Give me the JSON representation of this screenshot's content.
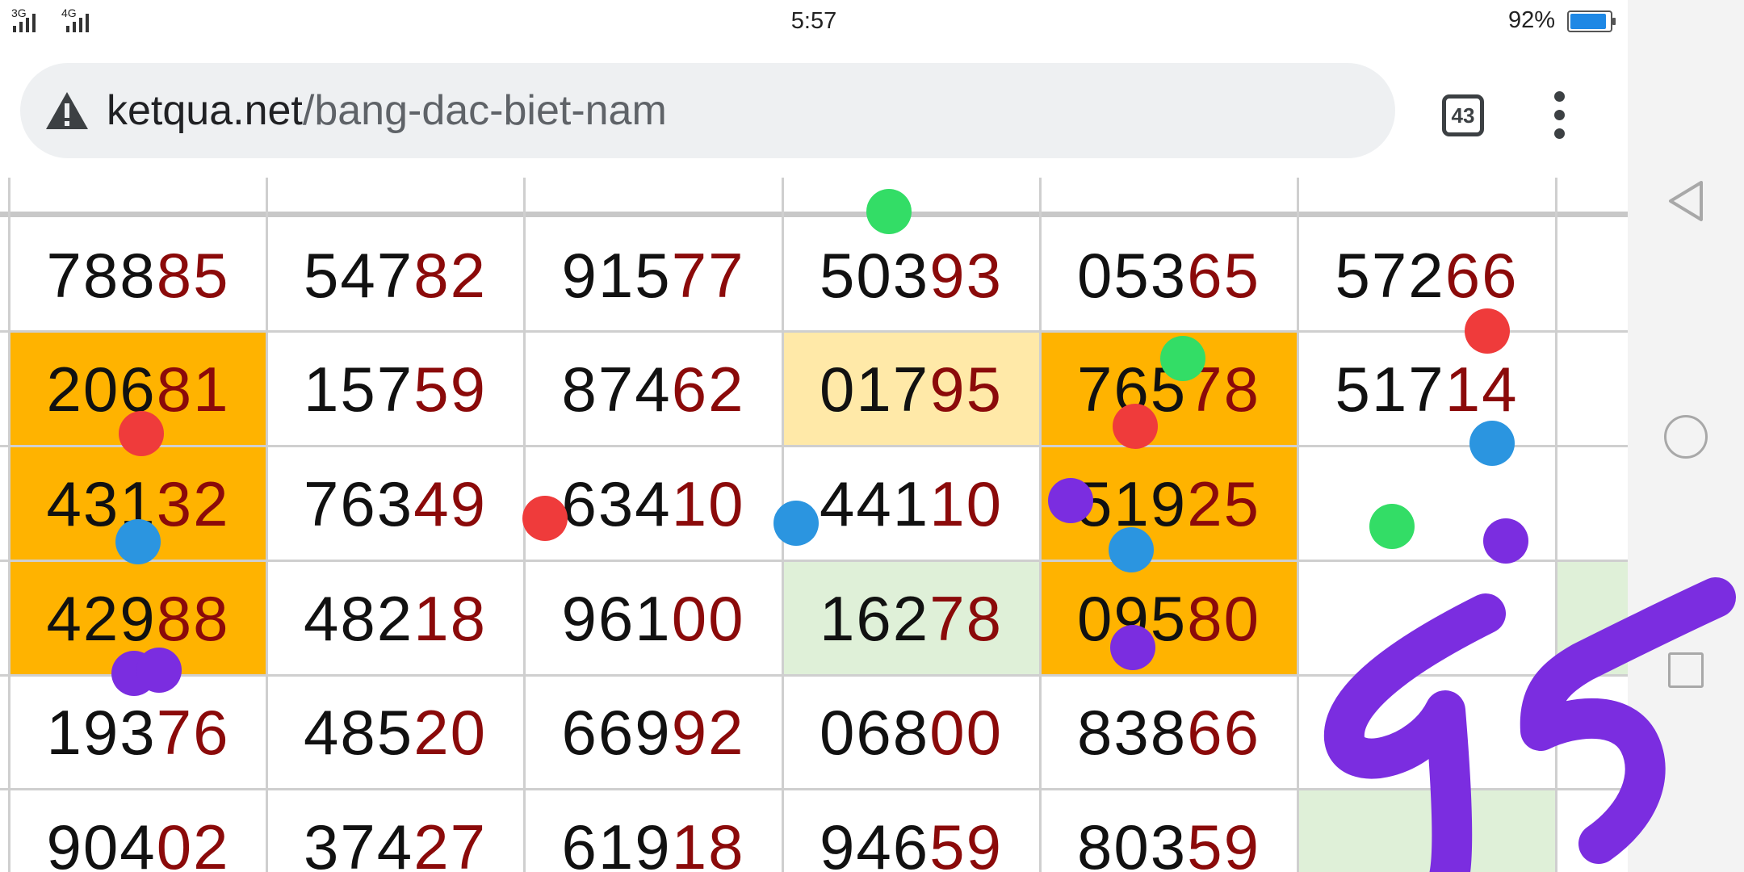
{
  "status_bar": {
    "network_1": "3G",
    "network_2": "4G",
    "time": "5:57",
    "battery_percent": "92%",
    "battery_level": 0.92
  },
  "browser": {
    "url_domain": "ketqua.net",
    "url_path": "/bang-dac-biet-nam",
    "tab_count": "43",
    "warning_icon": "warning-icon",
    "menu_icon": "more-vert-icon"
  },
  "colors": {
    "highlight_orange": "#ffb300",
    "highlight_light_yellow": "#ffe9a8",
    "highlight_light_green": "#dff0d8",
    "last_two_digits": "#8b0a0a",
    "mark_red": "#ef3b3b",
    "mark_green": "#33dd66",
    "mark_blue": "#2b95e0",
    "mark_purple": "#7b2de0"
  },
  "table": {
    "rows": [
      [
        {
          "p": "788",
          "s": "85",
          "bg": ""
        },
        {
          "p": "547",
          "s": "82",
          "bg": ""
        },
        {
          "p": "915",
          "s": "77",
          "bg": ""
        },
        {
          "p": "503",
          "s": "93",
          "bg": ""
        },
        {
          "p": "053",
          "s": "65",
          "bg": ""
        },
        {
          "p": "572",
          "s": "66",
          "bg": ""
        },
        {
          "p": "",
          "s": "",
          "bg": ""
        }
      ],
      [
        {
          "p": "206",
          "s": "81",
          "bg": "orange"
        },
        {
          "p": "157",
          "s": "59",
          "bg": ""
        },
        {
          "p": "874",
          "s": "62",
          "bg": ""
        },
        {
          "p": "017",
          "s": "95",
          "bg": "yellow"
        },
        {
          "p": "765",
          "s": "78",
          "bg": "orange"
        },
        {
          "p": "517",
          "s": "14",
          "bg": ""
        },
        {
          "p": "",
          "s": "",
          "bg": ""
        }
      ],
      [
        {
          "p": "431",
          "s": "32",
          "bg": "orange"
        },
        {
          "p": "763",
          "s": "49",
          "bg": ""
        },
        {
          "p": "634",
          "s": "10",
          "bg": ""
        },
        {
          "p": "441",
          "s": "10",
          "bg": ""
        },
        {
          "p": "519",
          "s": "25",
          "bg": "orange"
        },
        {
          "p": "",
          "s": "",
          "bg": ""
        },
        {
          "p": "",
          "s": "",
          "bg": ""
        }
      ],
      [
        {
          "p": "429",
          "s": "88",
          "bg": "orange"
        },
        {
          "p": "482",
          "s": "18",
          "bg": ""
        },
        {
          "p": "961",
          "s": "00",
          "bg": ""
        },
        {
          "p": "162",
          "s": "78",
          "bg": "green"
        },
        {
          "p": "095",
          "s": "80",
          "bg": "orange"
        },
        {
          "p": "",
          "s": "",
          "bg": ""
        },
        {
          "p": "",
          "s": "",
          "bg": "green"
        }
      ],
      [
        {
          "p": "193",
          "s": "76",
          "bg": ""
        },
        {
          "p": "485",
          "s": "20",
          "bg": ""
        },
        {
          "p": "669",
          "s": "92",
          "bg": ""
        },
        {
          "p": "068",
          "s": "00",
          "bg": ""
        },
        {
          "p": "838",
          "s": "66",
          "bg": ""
        },
        {
          "p": "",
          "s": "",
          "bg": ""
        },
        {
          "p": "",
          "s": "",
          "bg": ""
        }
      ],
      [
        {
          "p": "904",
          "s": "02",
          "bg": ""
        },
        {
          "p": "374",
          "s": "27",
          "bg": ""
        },
        {
          "p": "619",
          "s": "18",
          "bg": ""
        },
        {
          "p": "946",
          "s": "59",
          "bg": ""
        },
        {
          "p": "803",
          "s": "59",
          "bg": ""
        },
        {
          "p": "",
          "s": "",
          "bg": "green"
        },
        {
          "p": "",
          "s": "",
          "bg": ""
        }
      ]
    ]
  },
  "annotation": {
    "handwritten_text": "95"
  },
  "nav_bar": {
    "back_icon": "back-triangle-icon",
    "home_icon": "home-circle-icon",
    "recents_icon": "recents-square-icon"
  }
}
